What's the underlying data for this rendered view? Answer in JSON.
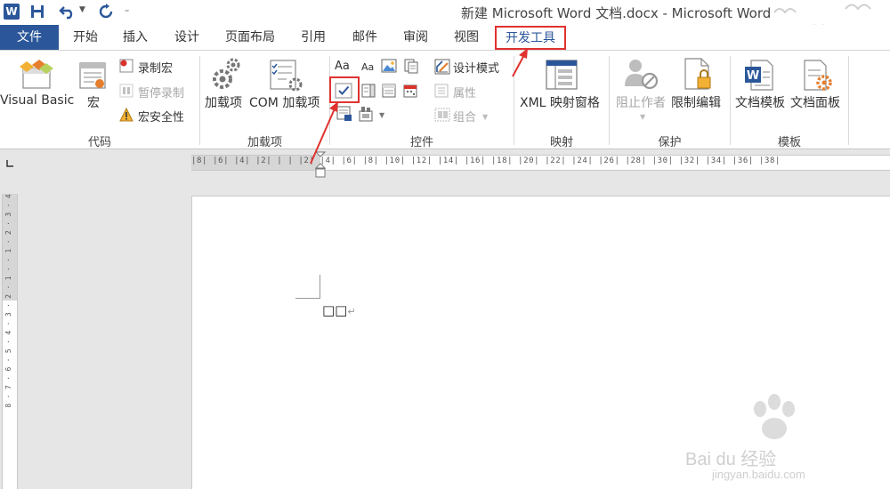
{
  "title_bar": {
    "app_logo": "W",
    "title": "新建 Microsoft Word 文档.docx - Microsoft Word"
  },
  "tabs": [
    "文件",
    "开始",
    "插入",
    "设计",
    "页面布局",
    "引用",
    "邮件",
    "审阅",
    "视图",
    "开发工具"
  ],
  "ribbon": {
    "code": {
      "label": "代码",
      "visual_basic": "Visual Basic",
      "macros": "宏",
      "record_macro": "录制宏",
      "pause_recording": "暂停录制",
      "macro_security": "宏安全性"
    },
    "addins": {
      "label": "加载项",
      "addins": "加载项",
      "com_addins": "COM 加载项"
    },
    "controls": {
      "label": "控件",
      "design_mode": "设计模式",
      "properties": "属性",
      "group": "组合"
    },
    "mapping": {
      "label": "映射",
      "xml_pane": "XML 映射窗格"
    },
    "protect": {
      "label": "保护",
      "block_authors": "阻止作者",
      "restrict_editing": "限制编辑"
    },
    "templates": {
      "label": "模板",
      "document_template": "文档模板",
      "document_panel": "文档面板"
    }
  },
  "ruler": {
    "horizontal": "|8|  |6|  |4|  |2|  |  |  |2|  |4|  |6|  |8|  |10|  |12|  |14|  |16|  |18|  |20|  |22|  |24|  |26|  |28|  |30|  |32|  |34|  |36|  |38|",
    "vertical": "8 · 7 · 6 · 5 · 4 · 3 · 2 · 1 · · 1 · 2 · 3 · 4"
  },
  "document": {
    "text": "□□",
    "para_mark": "↵"
  },
  "watermark": {
    "text": "Bai du 经验",
    "url": "jingyan.baidu.com"
  },
  "colors": {
    "word_blue": "#2b579a",
    "highlight_red": "#e0322f"
  }
}
